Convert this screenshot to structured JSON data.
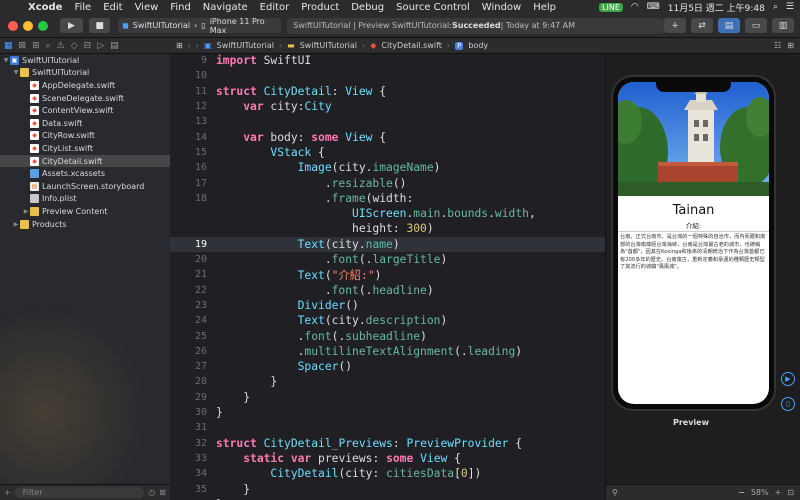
{
  "menubar": {
    "app": "Xcode",
    "items": [
      "File",
      "Edit",
      "View",
      "Find",
      "Navigate",
      "Editor",
      "Product",
      "Debug",
      "Source Control",
      "Window",
      "Help"
    ],
    "status_badge": "LINE",
    "clock": "11月5日 週二 上午9:48"
  },
  "toolbar": {
    "scheme": "SwiftUITutorial",
    "device": "iPhone 11 Pro Max",
    "activity_prefix": "SwiftUITutorial | Preview SwiftUITutorial: ",
    "activity_status": "Succeeded",
    "activity_time": " | Today at 9:47 AM"
  },
  "navigator": {
    "rows": [
      {
        "name": "SwiftUITutorial",
        "icon": "project",
        "depth": 0,
        "disclosure": "▼"
      },
      {
        "name": "SwiftUITutorial",
        "icon": "folder",
        "depth": 1,
        "disclosure": "▼"
      },
      {
        "name": "AppDelegate.swift",
        "icon": "swift",
        "depth": 2,
        "disclosure": ""
      },
      {
        "name": "SceneDelegate.swift",
        "icon": "swift",
        "depth": 2,
        "disclosure": ""
      },
      {
        "name": "ContentView.swift",
        "icon": "swift",
        "depth": 2,
        "disclosure": ""
      },
      {
        "name": "Data.swift",
        "icon": "swift",
        "depth": 2,
        "disclosure": ""
      },
      {
        "name": "CityRow.swift",
        "icon": "swift",
        "depth": 2,
        "disclosure": ""
      },
      {
        "name": "CityList.swift",
        "icon": "swift",
        "depth": 2,
        "disclosure": ""
      },
      {
        "name": "CityDetail.swift",
        "icon": "swift",
        "depth": 2,
        "disclosure": "",
        "selected": true
      },
      {
        "name": "Assets.xcassets",
        "icon": "assets",
        "depth": 2,
        "disclosure": ""
      },
      {
        "name": "LaunchScreen.storyboard",
        "icon": "storyboard",
        "depth": 2,
        "disclosure": ""
      },
      {
        "name": "Info.plist",
        "icon": "plist",
        "depth": 2,
        "disclosure": ""
      },
      {
        "name": "Preview Content",
        "icon": "folder",
        "depth": 2,
        "disclosure": "▶"
      },
      {
        "name": "Products",
        "icon": "folder",
        "depth": 1,
        "disclosure": "▶"
      }
    ],
    "filter_placeholder": "Filter"
  },
  "jumpbar": {
    "items": [
      "SwiftUITutorial",
      "SwiftUITutorial",
      "CityDetail.swift",
      "body"
    ]
  },
  "editor": {
    "current_line": 19,
    "lines": [
      {
        "n": "9",
        "tokens": [
          [
            "kw",
            "import"
          ],
          [
            "pl",
            " SwiftUI"
          ]
        ]
      },
      {
        "n": "10",
        "tokens": []
      },
      {
        "n": "11",
        "tokens": [
          [
            "kw",
            "struct"
          ],
          [
            "pl",
            " "
          ],
          [
            "ty",
            "CityDetail"
          ],
          [
            "pl",
            ": "
          ],
          [
            "ty",
            "View"
          ],
          [
            "pl",
            " {"
          ]
        ]
      },
      {
        "n": "12",
        "tokens": [
          [
            "pl",
            "    "
          ],
          [
            "kw",
            "var"
          ],
          [
            "pl",
            " city:"
          ],
          [
            "ty",
            "City"
          ]
        ]
      },
      {
        "n": "13",
        "tokens": []
      },
      {
        "n": "14",
        "tokens": [
          [
            "pl",
            "    "
          ],
          [
            "kw",
            "var"
          ],
          [
            "pl",
            " body: "
          ],
          [
            "kw",
            "some"
          ],
          [
            "pl",
            " "
          ],
          [
            "ty",
            "View"
          ],
          [
            "pl",
            " {"
          ]
        ]
      },
      {
        "n": "15",
        "tokens": [
          [
            "pl",
            "        "
          ],
          [
            "ty",
            "VStack"
          ],
          [
            "pl",
            " {"
          ]
        ]
      },
      {
        "n": "16",
        "tokens": [
          [
            "pl",
            "            "
          ],
          [
            "ty",
            "Image"
          ],
          [
            "pl",
            "(city."
          ],
          [
            "fn",
            "imageName"
          ],
          [
            "pl",
            ")"
          ]
        ]
      },
      {
        "n": "17",
        "tokens": [
          [
            "pl",
            "                ."
          ],
          [
            "fn",
            "resizable"
          ],
          [
            "pl",
            "()"
          ]
        ]
      },
      {
        "n": "18",
        "tokens": [
          [
            "pl",
            "                ."
          ],
          [
            "fn",
            "frame"
          ],
          [
            "pl",
            "(width:"
          ]
        ]
      },
      {
        "n": "",
        "tokens": [
          [
            "pl",
            "                    "
          ],
          [
            "ty",
            "UIScreen"
          ],
          [
            "pl",
            "."
          ],
          [
            "fn",
            "main"
          ],
          [
            "pl",
            "."
          ],
          [
            "fn",
            "bounds"
          ],
          [
            "pl",
            "."
          ],
          [
            "fn",
            "width"
          ],
          [
            "pl",
            ","
          ]
        ]
      },
      {
        "n": "",
        "tokens": [
          [
            "pl",
            "                    height: "
          ],
          [
            "nm",
            "300"
          ],
          [
            "pl",
            ")"
          ]
        ]
      },
      {
        "n": "19",
        "tokens": [
          [
            "pl",
            "            "
          ],
          [
            "ty",
            "Text"
          ],
          [
            "pl",
            "(city."
          ],
          [
            "fn",
            "name"
          ],
          [
            "pl",
            ")"
          ]
        ]
      },
      {
        "n": "20",
        "tokens": [
          [
            "pl",
            "                ."
          ],
          [
            "fn",
            "font"
          ],
          [
            "pl",
            "(."
          ],
          [
            "fn",
            "largeTitle"
          ],
          [
            "pl",
            ")"
          ]
        ]
      },
      {
        "n": "21",
        "tokens": [
          [
            "pl",
            "            "
          ],
          [
            "ty",
            "Text"
          ],
          [
            "pl",
            "("
          ],
          [
            "st",
            "\"介紹:\""
          ],
          [
            "pl",
            ")"
          ]
        ]
      },
      {
        "n": "22",
        "tokens": [
          [
            "pl",
            "                ."
          ],
          [
            "fn",
            "font"
          ],
          [
            "pl",
            "(."
          ],
          [
            "fn",
            "headline"
          ],
          [
            "pl",
            ")"
          ]
        ]
      },
      {
        "n": "23",
        "tokens": [
          [
            "pl",
            "            "
          ],
          [
            "ty",
            "Divider"
          ],
          [
            "pl",
            "()"
          ]
        ]
      },
      {
        "n": "24",
        "tokens": [
          [
            "pl",
            "            "
          ],
          [
            "ty",
            "Text"
          ],
          [
            "pl",
            "(city."
          ],
          [
            "fn",
            "description"
          ],
          [
            "pl",
            ")"
          ]
        ]
      },
      {
        "n": "25",
        "tokens": [
          [
            "pl",
            "            ."
          ],
          [
            "fn",
            "font"
          ],
          [
            "pl",
            "(."
          ],
          [
            "fn",
            "subheadline"
          ],
          [
            "pl",
            ")"
          ]
        ]
      },
      {
        "n": "26",
        "tokens": [
          [
            "pl",
            "            ."
          ],
          [
            "fn",
            "multilineTextAlignment"
          ],
          [
            "pl",
            "(."
          ],
          [
            "fn",
            "leading"
          ],
          [
            "pl",
            ")"
          ]
        ]
      },
      {
        "n": "27",
        "tokens": [
          [
            "pl",
            "            "
          ],
          [
            "ty",
            "Spacer"
          ],
          [
            "pl",
            "()"
          ]
        ]
      },
      {
        "n": "28",
        "tokens": [
          [
            "pl",
            "        }"
          ]
        ]
      },
      {
        "n": "29",
        "tokens": [
          [
            "pl",
            "    }"
          ]
        ]
      },
      {
        "n": "30",
        "tokens": [
          [
            "pl",
            "}"
          ]
        ]
      },
      {
        "n": "31",
        "tokens": []
      },
      {
        "n": "32",
        "tokens": [
          [
            "kw",
            "struct"
          ],
          [
            "pl",
            " "
          ],
          [
            "ty",
            "CityDetail_Previews"
          ],
          [
            "pl",
            ": "
          ],
          [
            "ty",
            "PreviewProvider"
          ],
          [
            "pl",
            " {"
          ]
        ]
      },
      {
        "n": "33",
        "tokens": [
          [
            "pl",
            "    "
          ],
          [
            "kw",
            "static var"
          ],
          [
            "pl",
            " previews: "
          ],
          [
            "kw",
            "some"
          ],
          [
            "pl",
            " "
          ],
          [
            "ty",
            "View"
          ],
          [
            "pl",
            " {"
          ]
        ]
      },
      {
        "n": "34",
        "tokens": [
          [
            "pl",
            "        "
          ],
          [
            "ty",
            "CityDetail"
          ],
          [
            "pl",
            "(city: "
          ],
          [
            "fn",
            "citiesData"
          ],
          [
            "pl",
            "["
          ],
          [
            "nm",
            "0"
          ],
          [
            "pl",
            "])"
          ]
        ]
      },
      {
        "n": "35",
        "tokens": [
          [
            "pl",
            "    }"
          ]
        ]
      },
      {
        "n": "36",
        "tokens": [
          [
            "pl",
            "}"
          ]
        ]
      }
    ]
  },
  "preview": {
    "city_name": "Tainan",
    "intro": "介紹:",
    "description": "台南，正式台南市，是台灣的一個特殊的自治市，而內而跟和南部的台灣南端經台灣海峽，台南是台灣最古老的城市，也被稱為\"首都\"，因其在Koxinga和後來的清朝統治下作為台灣首都已有200多年的歷史。台南復古，重新定義和豪邁的種類歷史類型了其流行的城鎮\"風風城\"。",
    "label": "Preview",
    "zoom": "58%"
  },
  "colors": {
    "accent": "#4a9eff",
    "traffic_red": "#ff5f57",
    "traffic_yellow": "#febc2e",
    "traffic_green": "#28c840"
  }
}
